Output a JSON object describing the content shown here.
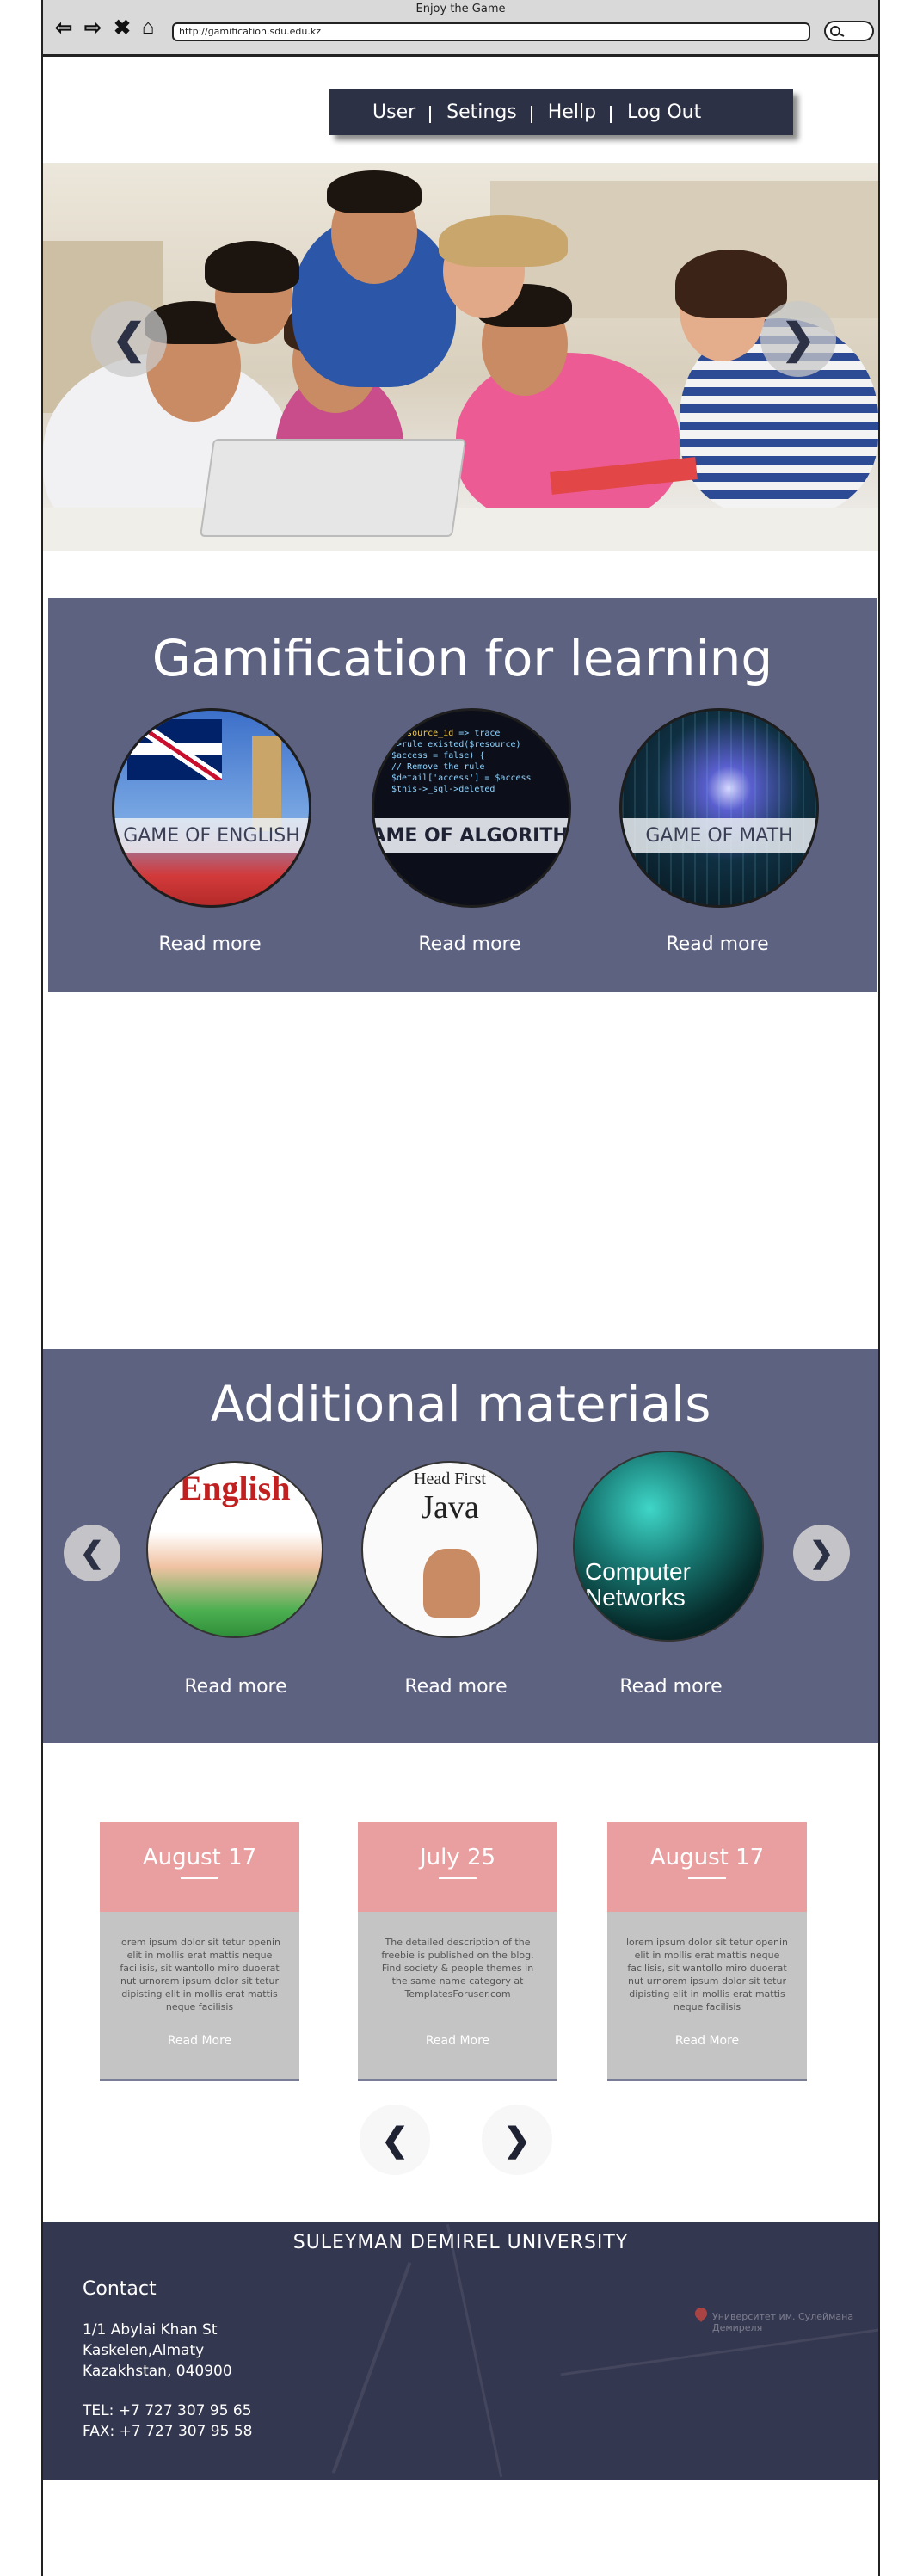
{
  "browser": {
    "title": "Enjoy the Game",
    "url": "http://gamification.sdu.edu.kz",
    "icons": [
      "back-arrow-icon",
      "forward-arrow-icon",
      "close-icon",
      "home-icon",
      "search-icon"
    ]
  },
  "menu": {
    "items": [
      {
        "label": "User"
      },
      {
        "label": "Setings"
      },
      {
        "label": "Hellp"
      },
      {
        "label": "Log Out"
      }
    ]
  },
  "hero": {
    "prev_icon": "❮",
    "next_icon": "❯"
  },
  "gamification": {
    "title": "Gamification for learning",
    "games": [
      {
        "label": "GAME OF ENGLISH",
        "link": "Read more"
      },
      {
        "label": "GAME OF ALGORITHM",
        "link": "Read more"
      },
      {
        "label": "GAME OF MATH",
        "link": "Read more"
      }
    ]
  },
  "materials": {
    "title": "Additional materials",
    "prev_icon": "❮",
    "next_icon": "❯",
    "books": [
      {
        "cover_title": "English",
        "link": "Read more"
      },
      {
        "cover_title": "Head First",
        "cover_sub": "Java",
        "link": "Read more"
      },
      {
        "cover_title": "Computer",
        "cover_sub": "Networks",
        "link": "Read more"
      }
    ]
  },
  "posts": [
    {
      "date": "August 17",
      "text": "lorem ipsum dolor sit tetur openin elit in mollis erat mattis neque facilisis, sit wantollo miro duoerat nut urnorem ipsum dolor sit tetur dipisting elit in mollis erat mattis neque facilisis",
      "link": "Read More"
    },
    {
      "date": "July 25",
      "text": "The detailed description of the freebie is published on the blog. Find society & people themes in the same name category at TemplatesForuser.com",
      "link": "Read More"
    },
    {
      "date": "August 17",
      "text": "lorem ipsum dolor sit tetur openin elit in mollis erat mattis neque facilisis, sit wantollo miro duoerat nut urnorem ipsum dolor sit tetur dipisting elit in mollis erat mattis neque facilisis",
      "link": "Read More"
    }
  ],
  "pager": {
    "prev": "❮",
    "next": "❯"
  },
  "footer": {
    "title": "SULEYMAN DEMIREL UNIVERSITY",
    "contact_heading": "Contact",
    "address": [
      "1/1 Abylai Khan St",
      "Kaskelen,Almaty",
      "Kazakhstan, 040900"
    ],
    "tel": "TEL: +7 727 307 95 65",
    "fax": "FAX: +7 727 307 95 58",
    "map_label": "Университет им. Сулеймана Демиреля"
  }
}
